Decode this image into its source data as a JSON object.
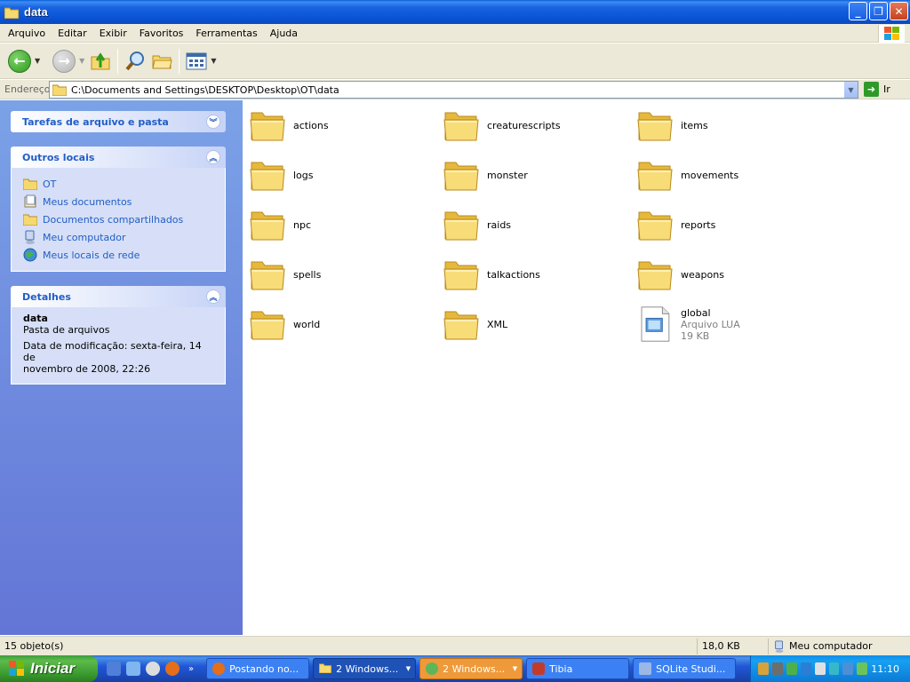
{
  "window": {
    "title": "data"
  },
  "menu": {
    "items": [
      "Arquivo",
      "Editar",
      "Exibir",
      "Favoritos",
      "Ferramentas",
      "Ajuda"
    ]
  },
  "address": {
    "label": "Endereço",
    "path": "C:\\Documents and Settings\\DESKTOP\\Desktop\\OT\\data",
    "go_label": "Ir"
  },
  "left": {
    "tasks_title": "Tarefas de arquivo e pasta",
    "places_title": "Outros locais",
    "places": [
      {
        "label": "OT",
        "icon": "folder-icon"
      },
      {
        "label": "Meus documentos",
        "icon": "my-documents-icon"
      },
      {
        "label": "Documentos compartilhados",
        "icon": "shared-folder-icon"
      },
      {
        "label": "Meu computador",
        "icon": "my-computer-icon"
      },
      {
        "label": "Meus locais de rede",
        "icon": "network-places-icon"
      }
    ],
    "details_title": "Detalhes",
    "details": {
      "name": "data",
      "type": "Pasta de arquivos",
      "modified_line1": "Data de modificação: sexta-feira, 14 de",
      "modified_line2": "novembro de 2008, 22:26"
    }
  },
  "files": [
    {
      "name": "actions"
    },
    {
      "name": "creaturescripts"
    },
    {
      "name": "items"
    },
    {
      "name": "logs"
    },
    {
      "name": "monster"
    },
    {
      "name": "movements"
    },
    {
      "name": "npc"
    },
    {
      "name": "raids"
    },
    {
      "name": "reports"
    },
    {
      "name": "spells"
    },
    {
      "name": "talkactions"
    },
    {
      "name": "weapons"
    },
    {
      "name": "world"
    },
    {
      "name": "XML"
    },
    {
      "name": "global",
      "type": "Arquivo LUA",
      "size": "19 KB"
    }
  ],
  "status": {
    "count": "15 objeto(s)",
    "size": "18,0 KB",
    "location": "Meu computador"
  },
  "taskbar": {
    "start_label": "Iniciar",
    "tasks": [
      {
        "label": "Postando no...",
        "icon": "firefox-icon"
      },
      {
        "label": "2 Windows...",
        "icon": "folder-icon"
      },
      {
        "label": "2 Windows...",
        "icon": "users-icon"
      },
      {
        "label": "Tibia",
        "icon": "tibia-icon"
      },
      {
        "label": "SQLite Studi...",
        "icon": "sqlite-icon"
      }
    ],
    "clock": "11:10"
  },
  "colors": {
    "link_blue": "#215dc6",
    "panel_bg": "#d6dff7",
    "title_blue": "#0b55d8"
  }
}
